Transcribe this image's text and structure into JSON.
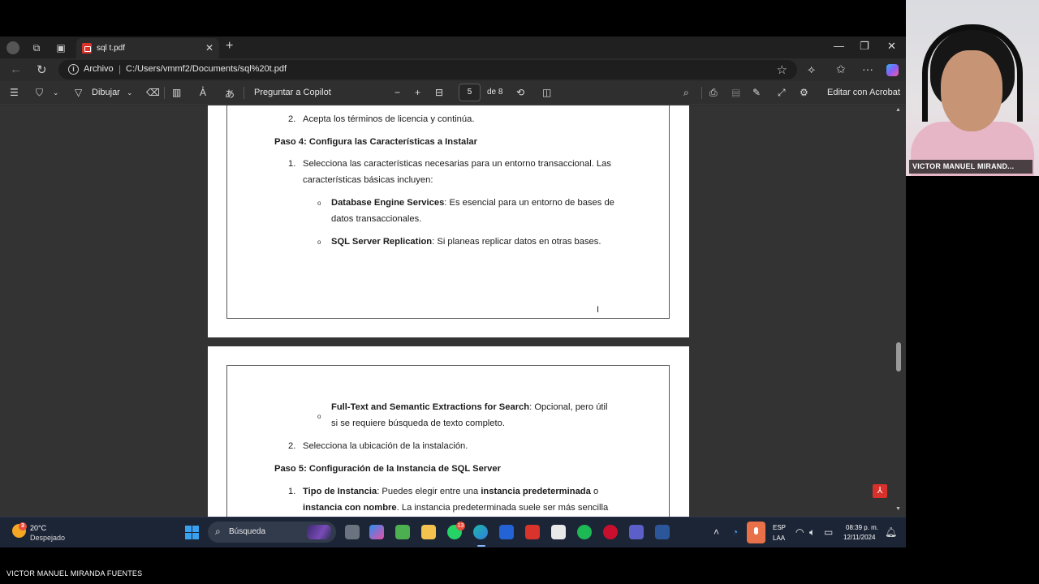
{
  "browser": {
    "tab_title": "sql t.pdf",
    "address": {
      "label": "Archivo",
      "separator": "|",
      "url": "C:/Users/vmmf2/Documents/sql%20t.pdf"
    }
  },
  "pdf_toolbar": {
    "draw_label": "Dibujar",
    "copilot_label": "Preguntar a Copilot",
    "current_page": "5",
    "total_pages": "de 8",
    "acrobat_label": "Editar con Acrobat"
  },
  "document": {
    "page_a": {
      "item_2": "2.",
      "item_2_text": "Acepta los términos de licencia y continúa.",
      "step4_heading": "Paso 4: Configura las Características a Instalar",
      "item_1": "1.",
      "item_1_line1": "Selecciona las características necesarias para un entorno transaccional. Las",
      "item_1_line2": "características básicas incluyen:",
      "bullet_1_bold": "Database Engine Services",
      "bullet_1_rest": ": Es esencial para un entorno de bases de",
      "bullet_1_line2": "datos transaccionales.",
      "bullet_2_bold": "SQL Server Replication",
      "bullet_2_rest": ": Si planeas replicar datos en otras bases."
    },
    "page_b": {
      "bullet_3_bold": "Full-Text and Semantic Extractions for Search",
      "bullet_3_rest": ": Opcional, pero útil",
      "bullet_3_line2": "si se requiere búsqueda de texto completo.",
      "item_2": "2.",
      "item_2_text": "Selecciona la ubicación de la instalación.",
      "step5_heading": "Paso 5: Configuración de la Instancia de SQL Server",
      "item_1": "1.",
      "item_1_bold": "Tipo de Instancia",
      "item_1_mid": ": Puedes elegir entre una ",
      "item_1_bold2": "instancia predeterminada",
      "item_1_end": " o",
      "item_1_line2_bold": "instancia con nombre",
      "item_1_line2_rest": ". La instancia predeterminada suele ser más sencilla"
    },
    "bullet_glyph": "o"
  },
  "taskbar": {
    "weather_badge": "3",
    "weather_temp": "20°C",
    "weather_desc": "Despejado",
    "search_placeholder": "Búsqueda",
    "whatsapp_badge": "13",
    "lang_top": "ESP",
    "lang_bottom": "LAA",
    "clock_time": "08:39 p. m.",
    "clock_date": "12/11/2024"
  },
  "webcam": {
    "participant_name": "VICTOR MANUEL MIRAND..."
  },
  "caption": "VICTOR MANUEL MIRANDA FUENTES",
  "colors": {
    "acrobat_red": "#d8302b",
    "taskbar_bg": "#1c2536",
    "viewer_bg": "#333333",
    "mic_orange": "#e8714a"
  },
  "icons": [
    "profile-icon",
    "workspaces-icon",
    "tab-actions-icon",
    "pdf-icon",
    "back-icon",
    "refresh-icon",
    "info-icon",
    "favorite-star-icon",
    "extensions-icon",
    "favorites-icon",
    "more-icon",
    "copilot-icon",
    "contents-icon",
    "highlight-icon",
    "draw-icon",
    "erase-icon",
    "page-view-icon",
    "read-aloud-icon",
    "translate-icon",
    "zoom-out-icon",
    "zoom-in-icon",
    "fit-page-icon",
    "rotate-icon",
    "two-page-icon",
    "search-icon",
    "print-icon",
    "save-icon",
    "save-as-icon",
    "fullscreen-icon",
    "settings-icon"
  ]
}
